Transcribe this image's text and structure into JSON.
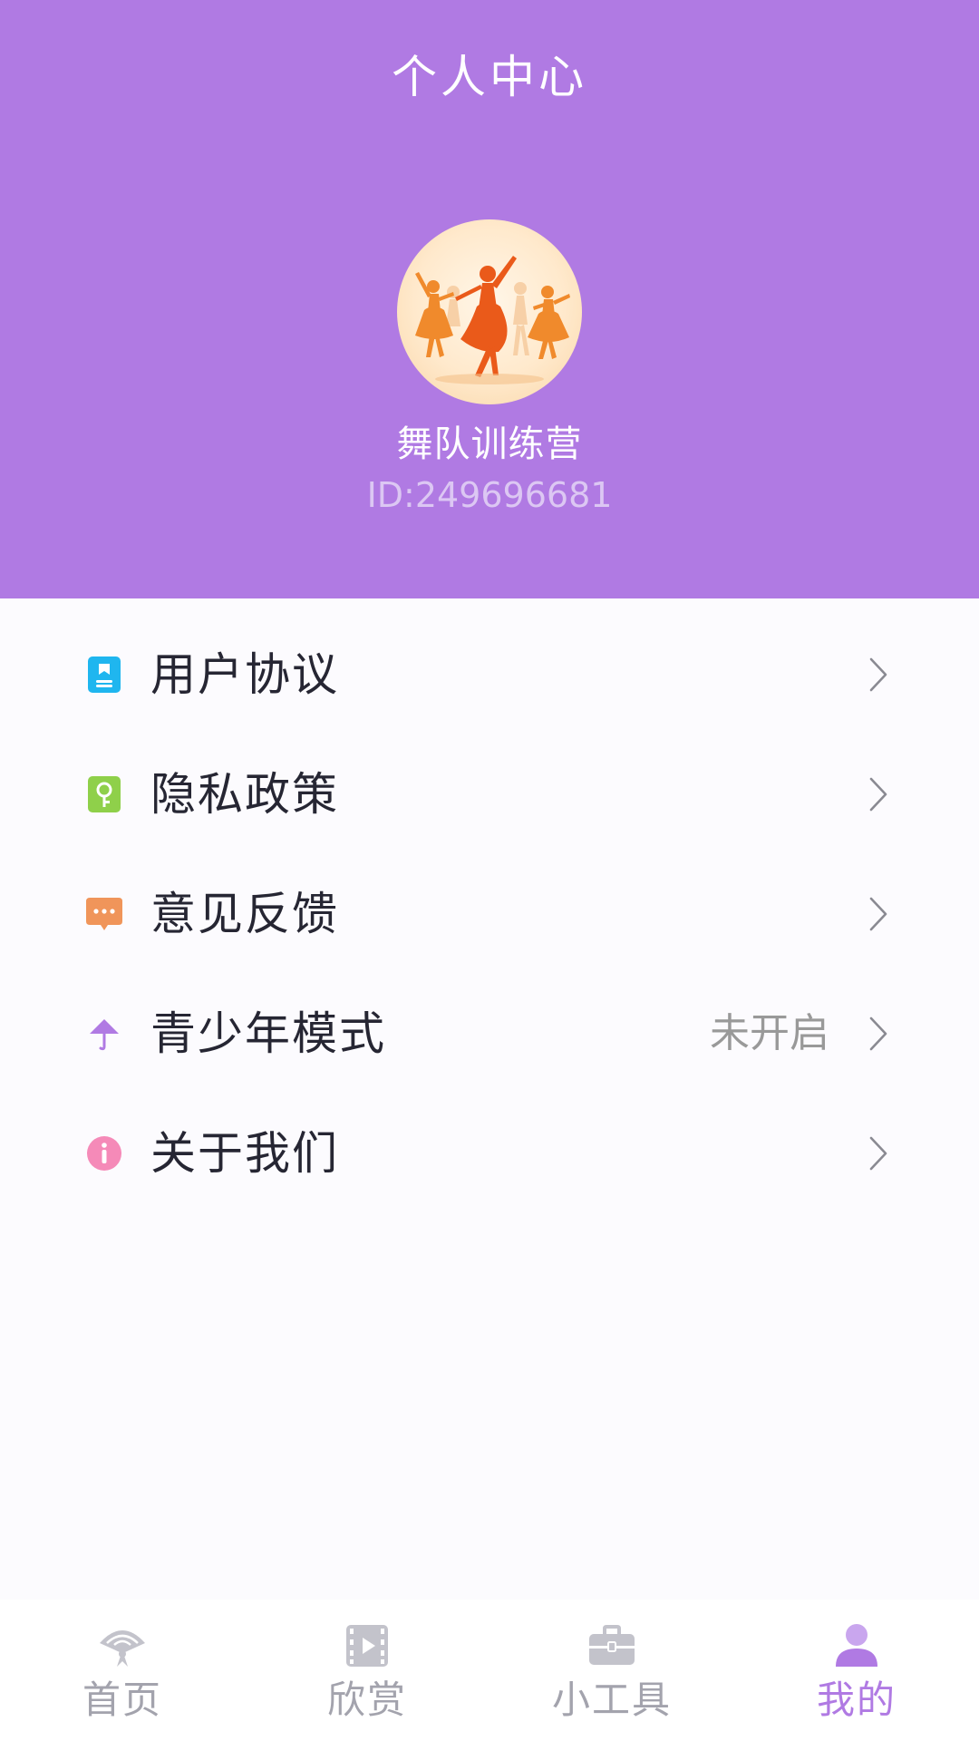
{
  "header": {
    "title": "个人中心",
    "user_name": "舞队训练营",
    "user_id": "ID:249696681",
    "background_color": "#b07ae3"
  },
  "menu": {
    "items": [
      {
        "label": "用户协议",
        "icon": "document-icon",
        "icon_color": "#1fb6ef",
        "value": ""
      },
      {
        "label": "隐私政策",
        "icon": "key-icon",
        "icon_color": "#8fd04a",
        "value": ""
      },
      {
        "label": "意见反馈",
        "icon": "message-icon",
        "icon_color": "#f0955a",
        "value": ""
      },
      {
        "label": "青少年模式",
        "icon": "umbrella-icon",
        "icon_color": "#b07ae3",
        "value": "未开启"
      },
      {
        "label": "关于我们",
        "icon": "info-icon",
        "icon_color": "#f58ab8",
        "value": ""
      }
    ]
  },
  "bottom_nav": {
    "items": [
      {
        "label": "首页",
        "icon": "fan-icon",
        "active": false
      },
      {
        "label": "欣赏",
        "icon": "video-icon",
        "active": false
      },
      {
        "label": "小工具",
        "icon": "toolbox-icon",
        "active": false
      },
      {
        "label": "我的",
        "icon": "user-icon",
        "active": true
      }
    ],
    "active_color": "#b07ae3",
    "inactive_color": "#a3a3ad"
  }
}
